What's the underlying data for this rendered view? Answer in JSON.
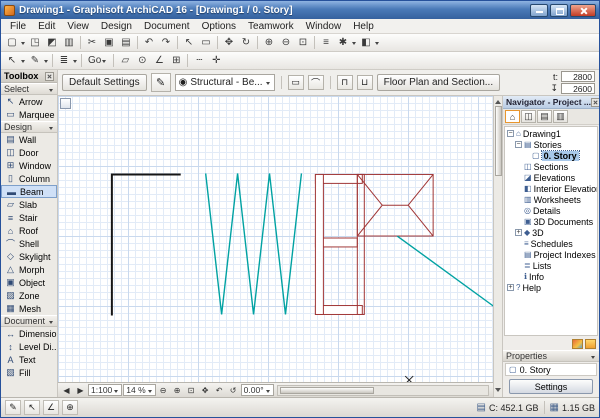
{
  "window": {
    "title": "Drawing1 - Graphisoft ArchiCAD 16 - [Drawing1 / 0. Story]"
  },
  "menu": {
    "items": [
      "File",
      "Edit",
      "View",
      "Design",
      "Document",
      "Options",
      "Teamwork",
      "Window",
      "Help"
    ]
  },
  "toolbar_main": {
    "icons": [
      {
        "name": "new",
        "glyph": "▢"
      },
      {
        "name": "open",
        "glyph": "◳"
      },
      {
        "name": "save",
        "glyph": "◩"
      },
      {
        "name": "print",
        "glyph": "▥"
      },
      {
        "name": "cut",
        "glyph": "✂"
      },
      {
        "name": "copy",
        "glyph": "▣"
      },
      {
        "name": "paste",
        "glyph": "▤"
      },
      {
        "name": "undo",
        "glyph": "↶"
      },
      {
        "name": "redo",
        "glyph": "↷"
      },
      {
        "name": "select-arrow",
        "glyph": "↖"
      },
      {
        "name": "marquee",
        "glyph": "▭"
      },
      {
        "name": "move",
        "glyph": "✥"
      },
      {
        "name": "rotate",
        "glyph": "↻"
      },
      {
        "name": "zoom-in",
        "glyph": "⊕"
      },
      {
        "name": "zoom-out",
        "glyph": "⊖"
      },
      {
        "name": "fit-in-window",
        "glyph": "⊡"
      },
      {
        "name": "layers",
        "glyph": "≡"
      },
      {
        "name": "options",
        "glyph": "✱"
      },
      {
        "name": "3d-window",
        "glyph": "◧"
      }
    ]
  },
  "toolbar_second": {
    "go_label": "Go",
    "icons": [
      {
        "name": "select-mode",
        "glyph": "↖"
      },
      {
        "name": "pen-set",
        "glyph": "✎"
      },
      {
        "name": "layer-settings",
        "glyph": "≣"
      },
      {
        "name": "virtual-trace",
        "glyph": "▱"
      },
      {
        "name": "snap-points",
        "glyph": "⊙"
      },
      {
        "name": "guide-lines",
        "glyph": "∠"
      },
      {
        "name": "grid-snap",
        "glyph": "⊞"
      },
      {
        "name": "dashed-line",
        "glyph": "┄"
      },
      {
        "name": "coordinates",
        "glyph": "✛"
      }
    ]
  },
  "infobar": {
    "default_settings": "Default Settings",
    "layer_combo": "Structural - Be...",
    "floor_plan_button": "Floor Plan and Section...",
    "t_label": "t:",
    "t_value": "2800",
    "h_value": "2600",
    "icons": [
      {
        "name": "beam-tool",
        "glyph": "✎"
      },
      {
        "name": "eye",
        "glyph": "◉"
      },
      {
        "name": "beam-straight",
        "glyph": "▭"
      },
      {
        "name": "beam-curved",
        "glyph": "⌒"
      },
      {
        "name": "reference-top",
        "glyph": "⊓"
      },
      {
        "name": "reference-bottom",
        "glyph": "⊔"
      },
      {
        "name": "elevation",
        "glyph": "↧"
      }
    ]
  },
  "toolbox": {
    "title": "Toolbox",
    "sections": [
      {
        "header": "Select",
        "items": [
          {
            "label": "Arrow",
            "glyph": "↖"
          },
          {
            "label": "Marquee",
            "glyph": "▭"
          }
        ]
      },
      {
        "header": "Design",
        "items": [
          {
            "label": "Wall",
            "glyph": "▤"
          },
          {
            "label": "Door",
            "glyph": "◫"
          },
          {
            "label": "Window",
            "glyph": "⊞"
          },
          {
            "label": "Column",
            "glyph": "▯"
          },
          {
            "label": "Beam",
            "glyph": "▬"
          },
          {
            "label": "Slab",
            "glyph": "▱"
          },
          {
            "label": "Stair",
            "glyph": "≡"
          },
          {
            "label": "Roof",
            "glyph": "⌂"
          },
          {
            "label": "Shell",
            "glyph": "⌒"
          },
          {
            "label": "Skylight",
            "glyph": "◇"
          },
          {
            "label": "Morph",
            "glyph": "△"
          },
          {
            "label": "Object",
            "glyph": "▣"
          },
          {
            "label": "Zone",
            "glyph": "▨"
          },
          {
            "label": "Mesh",
            "glyph": "▦"
          }
        ]
      },
      {
        "header": "Document",
        "items": [
          {
            "label": "Dimension",
            "glyph": "↔"
          },
          {
            "label": "Level Di...",
            "glyph": "↕"
          },
          {
            "label": "Text",
            "glyph": "A"
          },
          {
            "label": "Fill",
            "glyph": "▧"
          }
        ]
      }
    ]
  },
  "navigator": {
    "title": "Navigator - Project ...",
    "tabs": [
      {
        "name": "project-map",
        "glyph": "⌂"
      },
      {
        "name": "view-map",
        "glyph": "◫"
      },
      {
        "name": "layout-book",
        "glyph": "▤"
      },
      {
        "name": "publisher",
        "glyph": "▥"
      }
    ],
    "tree": [
      {
        "label": "Drawing1",
        "glyph": "⌂",
        "exp": "−"
      },
      {
        "label": "Stories",
        "glyph": "▤",
        "exp": "−"
      },
      {
        "label": "0. Story",
        "glyph": "▢"
      },
      {
        "label": "Sections",
        "glyph": "◫"
      },
      {
        "label": "Elevations",
        "glyph": "◪"
      },
      {
        "label": "Interior Elevations",
        "glyph": "◧"
      },
      {
        "label": "Worksheets",
        "glyph": "▥"
      },
      {
        "label": "Details",
        "glyph": "◎"
      },
      {
        "label": "3D Documents",
        "glyph": "▣"
      },
      {
        "label": "3D",
        "glyph": "◆",
        "exp": "+"
      },
      {
        "label": "Schedules",
        "glyph": "≡"
      },
      {
        "label": "Project Indexes",
        "glyph": "▤"
      },
      {
        "label": "Lists",
        "glyph": "≣"
      },
      {
        "label": "Info",
        "glyph": "ℹ"
      },
      {
        "label": "Help",
        "glyph": "?",
        "exp": "+"
      }
    ],
    "properties": {
      "header": "Properties",
      "story": "0. Story",
      "settings": "Settings"
    }
  },
  "canvas_toolbar": {
    "scale": "1:100",
    "zoom": "14 %",
    "angle": "0.00°",
    "icons": [
      {
        "name": "back",
        "glyph": "◀"
      },
      {
        "name": "forward",
        "glyph": "▶"
      },
      {
        "name": "zoom-out",
        "glyph": "⊖"
      },
      {
        "name": "zoom-in",
        "glyph": "⊕"
      },
      {
        "name": "fit",
        "glyph": "⊡"
      },
      {
        "name": "pan",
        "glyph": "✥"
      },
      {
        "name": "previous-zoom",
        "glyph": "↶"
      },
      {
        "name": "rotate-view",
        "glyph": "↺"
      }
    ]
  },
  "statusbar": {
    "disk_label": "C: 452.1 GB",
    "memory_label": "1.15 GB",
    "disk_glyph": "▤",
    "memory_glyph": "▦",
    "icons": [
      {
        "name": "pen-status",
        "glyph": "✎"
      },
      {
        "name": "cursor-status",
        "glyph": "↖"
      },
      {
        "name": "angle-status",
        "glyph": "∠"
      },
      {
        "name": "origin-status",
        "glyph": "⊕"
      }
    ]
  },
  "colors": {
    "titlebar_top": "#8fb3e2",
    "titlebar_bottom": "#35619e",
    "beam_teal": "#00a2a2",
    "outline_red": "#a03535",
    "selection_blue": "#a8c8ea",
    "grid_line": "#d9e5f4"
  }
}
